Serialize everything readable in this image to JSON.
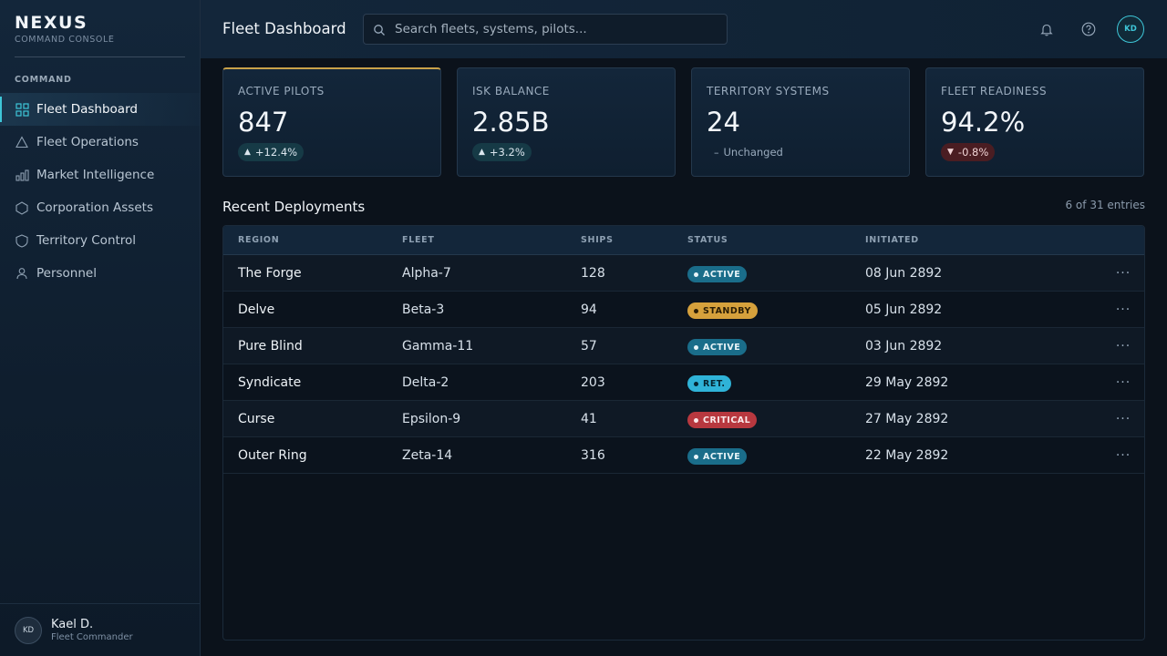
{
  "brand": {
    "name": "NEXUS",
    "subtitle": "COMMAND CONSOLE"
  },
  "sidebar": {
    "section_label": "COMMAND",
    "items": [
      {
        "label": "Fleet Dashboard",
        "icon": "grid-icon",
        "active": true
      },
      {
        "label": "Fleet Operations",
        "icon": "triangle-icon",
        "active": false
      },
      {
        "label": "Market Intelligence",
        "icon": "bar-chart-icon",
        "active": false
      },
      {
        "label": "Corporation Assets",
        "icon": "hexagon-icon",
        "active": false
      },
      {
        "label": "Territory Control",
        "icon": "shield-icon",
        "active": false
      },
      {
        "label": "Personnel",
        "icon": "person-icon",
        "active": false
      }
    ],
    "user": {
      "initials": "KD",
      "name": "Kael D.",
      "role": "Fleet Commander"
    }
  },
  "header": {
    "title": "Fleet Dashboard",
    "search_placeholder": "Search fleets, systems, pilots...",
    "avatar_initials": "KD"
  },
  "stats": [
    {
      "label": "ACTIVE PILOTS",
      "value": "847",
      "delta": "+12.4%",
      "trend": "up"
    },
    {
      "label": "ISK BALANCE",
      "value": "2.85B",
      "delta": "+3.2%",
      "trend": "up"
    },
    {
      "label": "TERRITORY SYSTEMS",
      "value": "24",
      "delta": "Unchanged",
      "trend": "flat"
    },
    {
      "label": "FLEET READINESS",
      "value": "94.2%",
      "delta": "-0.8%",
      "trend": "down"
    }
  ],
  "deployments": {
    "title": "Recent Deployments",
    "entries_text": "6 of 31 entries",
    "columns": [
      "REGION",
      "FLEET",
      "SHIPS",
      "STATUS",
      "INITIATED"
    ],
    "rows": [
      {
        "region": "The Forge",
        "fleet": "Alpha-7",
        "ships": "128",
        "status": "ACTIVE",
        "initiated": "08 Jun 2892"
      },
      {
        "region": "Delve",
        "fleet": "Beta-3",
        "ships": "94",
        "status": "STANDBY",
        "initiated": "05 Jun 2892"
      },
      {
        "region": "Pure Blind",
        "fleet": "Gamma-11",
        "ships": "57",
        "status": "ACTIVE",
        "initiated": "03 Jun 2892"
      },
      {
        "region": "Syndicate",
        "fleet": "Delta-2",
        "ships": "203",
        "status": "RET.",
        "initiated": "29 May 2892"
      },
      {
        "region": "Curse",
        "fleet": "Epsilon-9",
        "ships": "41",
        "status": "CRITICAL",
        "initiated": "27 May 2892"
      },
      {
        "region": "Outer Ring",
        "fleet": "Zeta-14",
        "ships": "316",
        "status": "ACTIVE",
        "initiated": "22 May 2892"
      }
    ],
    "more_label": "···"
  },
  "colors": {
    "accent": "#3ec6d8",
    "highlight": "#c9a24a",
    "active": "#1a6d8a",
    "standby": "#d6a13c",
    "retreat": "#2fb3d8",
    "critical": "#b8383f"
  }
}
